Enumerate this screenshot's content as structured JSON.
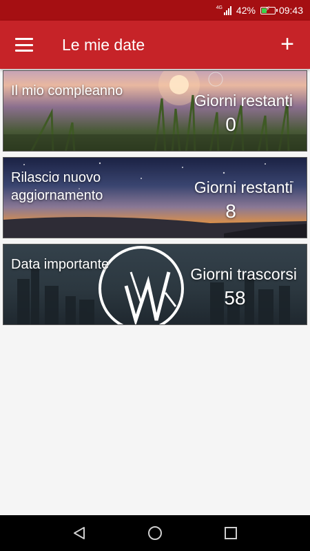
{
  "status_bar": {
    "network": "4G",
    "battery": "42%",
    "battery_level": 0.42,
    "time": "09:43"
  },
  "app_bar": {
    "title": "Le mie date"
  },
  "cards": [
    {
      "title": "Il mio compleanno",
      "metric_label": "Giorni restanti",
      "metric_value": "0"
    },
    {
      "title": "Rilascio nuovo aggiornamento",
      "metric_label": "Giorni restanti",
      "metric_value": "8"
    },
    {
      "title": "Data importante",
      "metric_label": "Giorni trascorsi",
      "metric_value": "58"
    }
  ],
  "colors": {
    "status_bar": "#a50f12",
    "app_bar": "#c62328",
    "background": "#f5f5f5",
    "nav_bar": "#000000"
  },
  "icons": {
    "menu": "hamburger-menu-icon",
    "add": "plus-icon",
    "back": "back-triangle-icon",
    "home": "home-circle-icon",
    "recents": "recents-square-icon"
  }
}
